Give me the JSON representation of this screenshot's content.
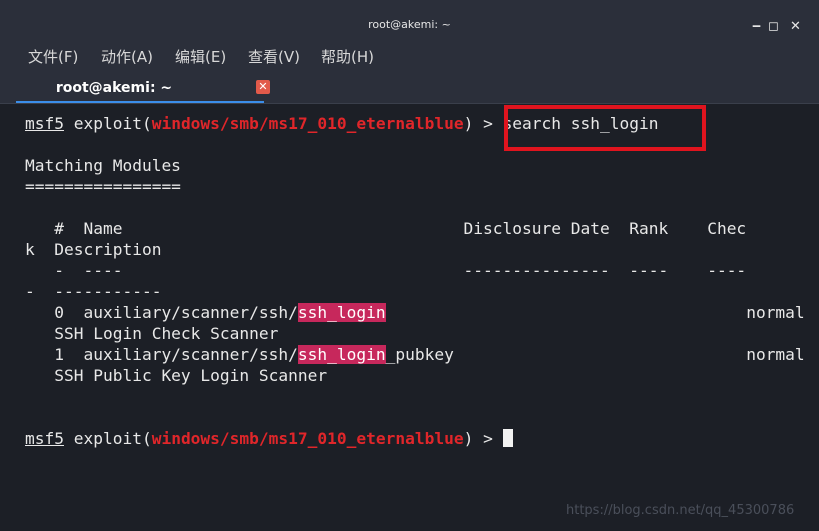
{
  "window": {
    "title": "root@akemi: ~",
    "minimize": "‒",
    "maximize": "◻",
    "close": "✕"
  },
  "menu": [
    "文件(F)",
    "动作(A)",
    "编辑(E)",
    "查看(V)",
    "帮助(H)"
  ],
  "tab": {
    "label": "root@akemi: ~",
    "close_icon": "✕"
  },
  "terminal": {
    "prompt_user": "msf5",
    "prompt_exploit_word": "exploit(",
    "prompt_module": "windows/smb/ms17_010_eternalblue",
    "prompt_end": ") > ",
    "command": "search ssh_login",
    "heading": "Matching Modules",
    "heading_rule": "================",
    "col_header_1": "   #  Name                                   Disclosure Date  Rank    Chec",
    "col_header_2": "k  Description",
    "col_rule_1": "   -  ----                                   ---------------  ----    ----",
    "col_rule_2": "-  -----------",
    "rows": [
      {
        "prefix": "   0  auxiliary/scanner/ssh/",
        "match": "ssh_login",
        "suffix": "                                     normal  No",
        "desc": "   SSH Login Check Scanner"
      },
      {
        "prefix": "   1  auxiliary/scanner/ssh/",
        "match": "ssh_login",
        "suffix": "_pubkey                              normal  No",
        "desc": "   SSH Public Key Login Scanner"
      }
    ]
  },
  "watermark": "https://blog.csdn.net/qq_45300786"
}
